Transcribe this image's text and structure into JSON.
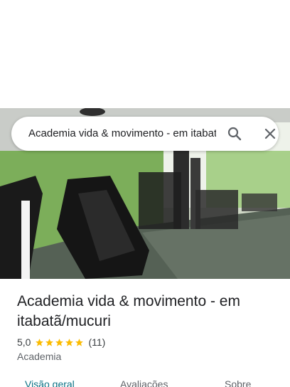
{
  "search": {
    "query": "Academia vida & movimento - em itabatã/mucuri"
  },
  "place": {
    "name": "Academia vida & movimento - em itabatã/mucuri",
    "rating": "5,0",
    "stars": 5,
    "review_count": "(11)",
    "category": "Academia"
  },
  "tabs": [
    {
      "label": "Visão geral",
      "active": true
    },
    {
      "label": "Avaliações",
      "active": false
    },
    {
      "label": "Sobre",
      "active": false
    }
  ],
  "colors": {
    "star": "#fbbc04",
    "active_tab": "#0b7285",
    "text": "#202124"
  },
  "icons": {
    "search": "search-icon",
    "close": "close-icon",
    "star": "star-icon"
  }
}
